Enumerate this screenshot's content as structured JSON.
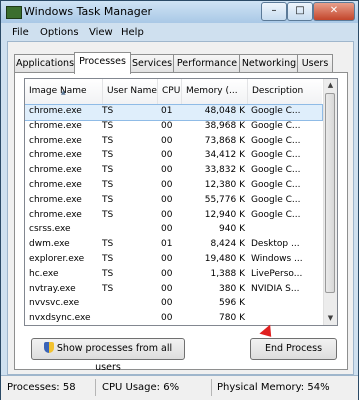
{
  "window": {
    "title": "Windows Task Manager"
  },
  "title_buttons": {
    "minimize": "–",
    "maximize": "□",
    "close": "✕"
  },
  "menu": [
    "File",
    "Options",
    "View",
    "Help"
  ],
  "tabs": [
    "Applications",
    "Processes",
    "Services",
    "Performance",
    "Networking",
    "Users"
  ],
  "active_tab": "Processes",
  "table": {
    "columns": [
      "Image Name",
      "User Name",
      "CPU",
      "Memory (...",
      "Description"
    ],
    "rows": [
      {
        "name": "chrome.exe",
        "user": "TS",
        "cpu": "01",
        "mem": "48,048 K",
        "desc": "Google C..."
      },
      {
        "name": "chrome.exe",
        "user": "TS",
        "cpu": "00",
        "mem": "38,968 K",
        "desc": "Google C..."
      },
      {
        "name": "chrome.exe",
        "user": "TS",
        "cpu": "00",
        "mem": "73,868 K",
        "desc": "Google C..."
      },
      {
        "name": "chrome.exe",
        "user": "TS",
        "cpu": "00",
        "mem": "34,412 K",
        "desc": "Google C..."
      },
      {
        "name": "chrome.exe",
        "user": "TS",
        "cpu": "00",
        "mem": "33,832 K",
        "desc": "Google C..."
      },
      {
        "name": "chrome.exe",
        "user": "TS",
        "cpu": "00",
        "mem": "12,380 K",
        "desc": "Google C..."
      },
      {
        "name": "chrome.exe",
        "user": "TS",
        "cpu": "00",
        "mem": "55,776 K",
        "desc": "Google C..."
      },
      {
        "name": "chrome.exe",
        "user": "TS",
        "cpu": "00",
        "mem": "12,940 K",
        "desc": "Google C..."
      },
      {
        "name": "csrss.exe",
        "user": "",
        "cpu": "00",
        "mem": "940 K",
        "desc": ""
      },
      {
        "name": "dwm.exe",
        "user": "TS",
        "cpu": "01",
        "mem": "8,424 K",
        "desc": "Desktop ..."
      },
      {
        "name": "explorer.exe",
        "user": "TS",
        "cpu": "00",
        "mem": "19,480 K",
        "desc": "Windows ..."
      },
      {
        "name": "hc.exe",
        "user": "TS",
        "cpu": "00",
        "mem": "1,388 K",
        "desc": "LivePerso..."
      },
      {
        "name": "nvtray.exe",
        "user": "TS",
        "cpu": "00",
        "mem": "380 K",
        "desc": "NVIDIA S..."
      },
      {
        "name": "nvvsvc.exe",
        "user": "",
        "cpu": "00",
        "mem": "596 K",
        "desc": ""
      },
      {
        "name": "nvxdsync.exe",
        "user": "",
        "cpu": "00",
        "mem": "780 K",
        "desc": ""
      }
    ],
    "selected_index": 0
  },
  "buttons": {
    "show_all": "Show processes from all users",
    "end_process": "End Process"
  },
  "status": {
    "processes": "Processes: 58",
    "cpu": "CPU Usage: 6%",
    "memory": "Physical Memory: 54%"
  },
  "colors": {
    "selection": "#dfeefb",
    "titlebar": "#a9c8e6"
  }
}
